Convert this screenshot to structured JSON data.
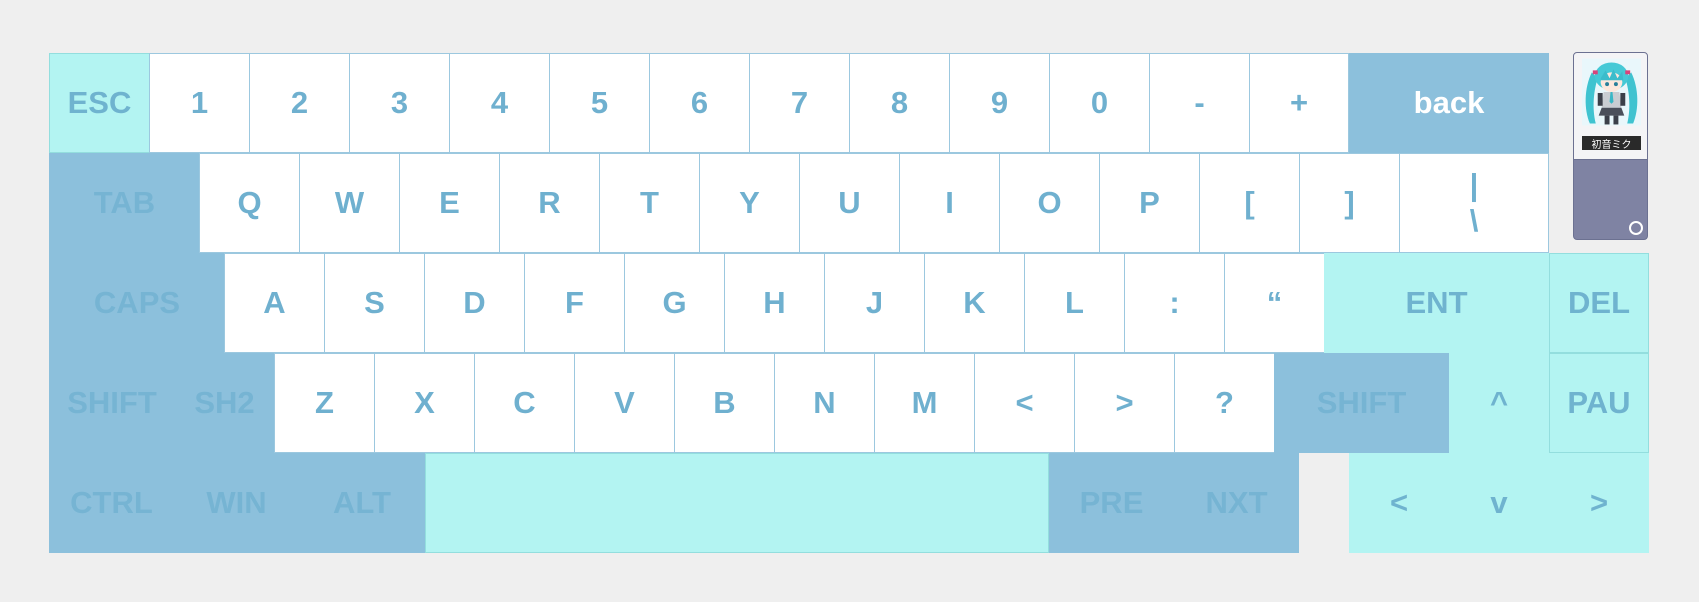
{
  "colors": {
    "white_key": "#ffffff",
    "cyan_key": "#b3f4f2",
    "blue_key": "#8cc0dc",
    "label_blue": "#6fb0cf",
    "background": "#efefef",
    "widget_bottom": "#7f83a3"
  },
  "keys": {
    "esc": "ESC",
    "k1": "1",
    "k2": "2",
    "k3": "3",
    "k4": "4",
    "k5": "5",
    "k6": "6",
    "k7": "7",
    "k8": "8",
    "k9": "9",
    "k0": "0",
    "minus": "-",
    "plus": "+",
    "backspace": "back",
    "tab": "TAB",
    "q": "Q",
    "w": "W",
    "e": "E",
    "r": "R",
    "t": "T",
    "y": "Y",
    "u": "U",
    "i": "I",
    "o": "O",
    "p": "P",
    "lbracket": "[",
    "rbracket": "]",
    "pipe": "|",
    "backslash": "\\",
    "caps": "CAPS",
    "a": "A",
    "s": "S",
    "d": "D",
    "f": "F",
    "g": "G",
    "h": "H",
    "j": "J",
    "k": "K",
    "l": "L",
    "colon": ":",
    "quote": "“",
    "enter": "ENT",
    "del": "DEL",
    "shift_left": "SHIFT",
    "sh2": "SH2",
    "z": "Z",
    "x": "X",
    "c": "C",
    "v": "V",
    "b": "B",
    "n": "N",
    "m": "M",
    "lt": "<",
    "gt": ">",
    "question": "?",
    "shift_right": "SHIFT",
    "up": "^",
    "pau": "PAU",
    "ctrl": "CTRL",
    "win": "WIN",
    "alt": "ALT",
    "space": "",
    "pre": "PRE",
    "nxt": "NXT",
    "left": "<",
    "down": "v",
    "right": ">"
  },
  "widget": {
    "icon": "hatsune-miku-avatar",
    "name": "初音ミク"
  }
}
